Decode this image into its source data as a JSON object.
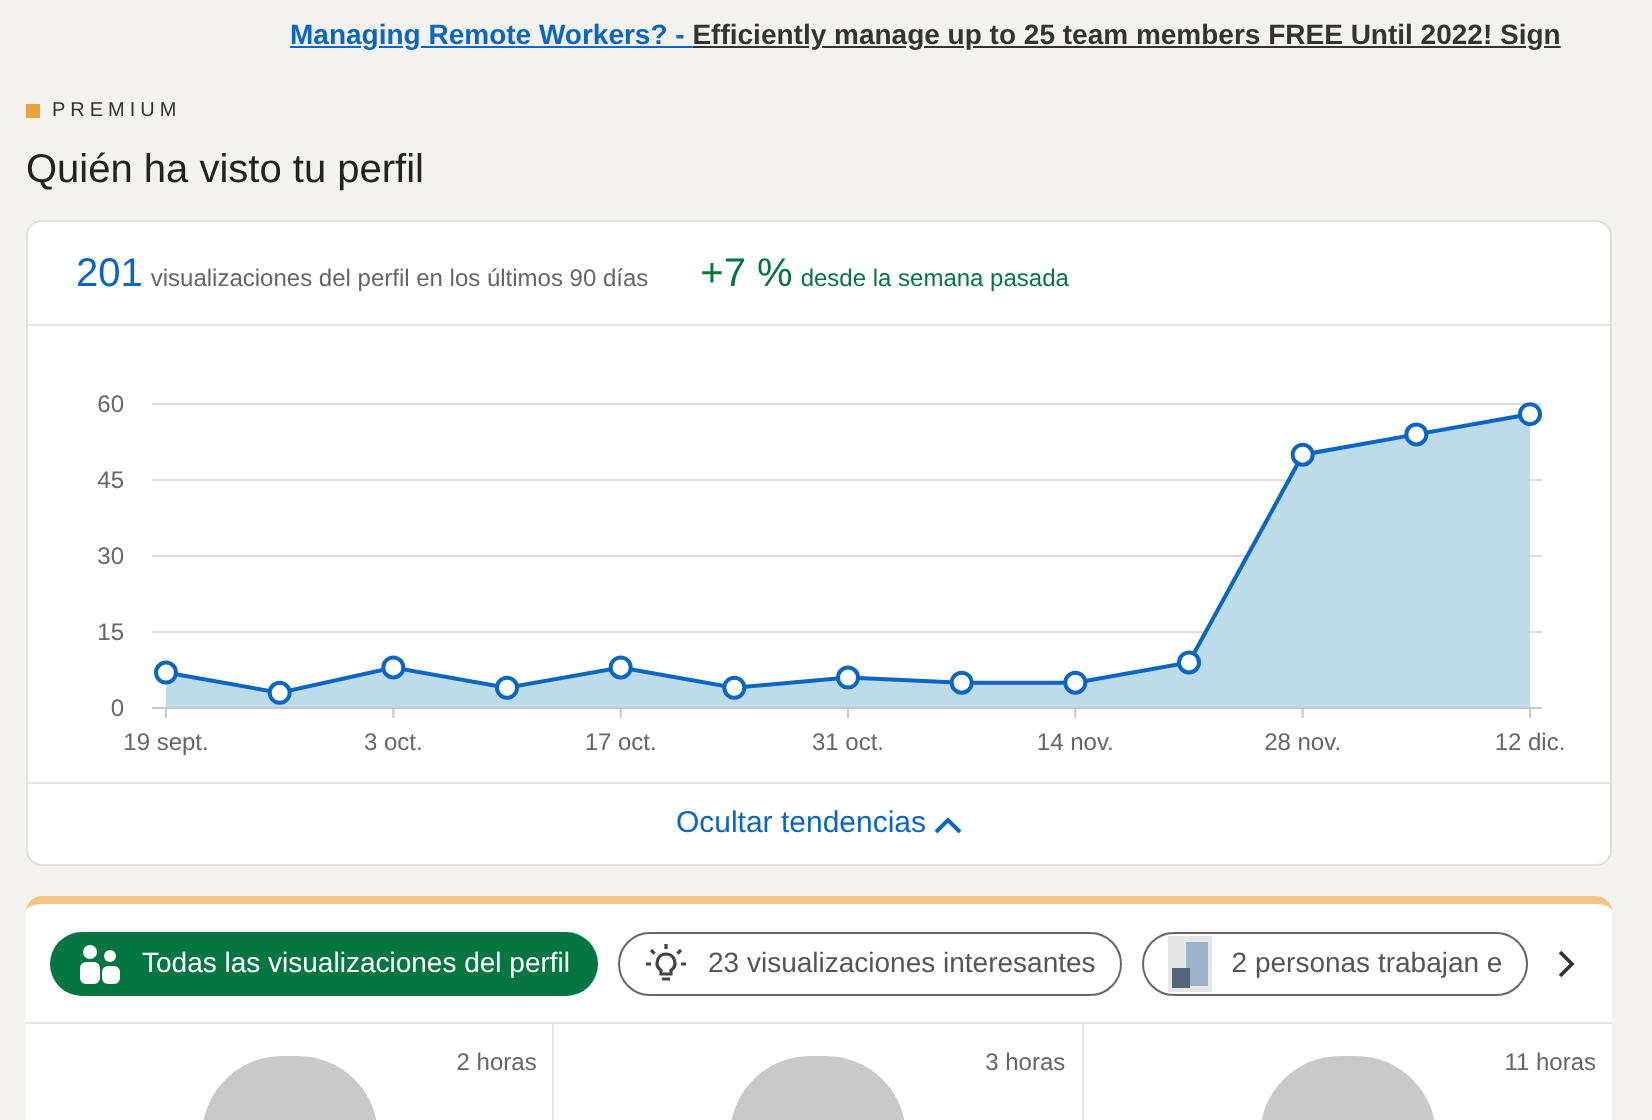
{
  "banner": {
    "link": "Managing Remote Workers? - ",
    "text": "Efficiently manage up to 25 team members FREE Until 2022! Sign"
  },
  "premium_label": "PREMIUM",
  "title": "Quién ha visto tu perfil",
  "stats": {
    "views": "201",
    "views_label": "visualizaciones del perfil en los últimos 90 días",
    "change": "+7 %",
    "change_label": "desde la semana pasada"
  },
  "chart_data": {
    "type": "area",
    "categories": [
      "19 sept.",
      null,
      "3 oct.",
      null,
      "17 oct.",
      null,
      "31 oct.",
      null,
      "14 nov.",
      null,
      "28 nov.",
      null,
      "12 dic."
    ],
    "series": [
      {
        "color": "#0a66c2",
        "values": [
          7,
          3,
          8,
          4,
          8,
          4,
          6,
          5,
          5,
          9,
          50,
          54,
          58
        ]
      }
    ],
    "ylim": [
      0,
      60
    ],
    "yticks": [
      0,
      15,
      30,
      45,
      60
    ],
    "grid": true
  },
  "toggle": "Ocultar tendencias",
  "filters": [
    {
      "kind": "people",
      "label": "Todas las visualizaciones del perfil",
      "selected": true
    },
    {
      "kind": "insight",
      "label": "23 visualizaciones interesantes",
      "selected": false
    },
    {
      "kind": "company",
      "label": "2 personas trabajan e",
      "selected": false
    }
  ],
  "viewers": [
    {
      "time": "2 horas"
    },
    {
      "time": "3 horas"
    },
    {
      "time": "11 horas"
    }
  ]
}
